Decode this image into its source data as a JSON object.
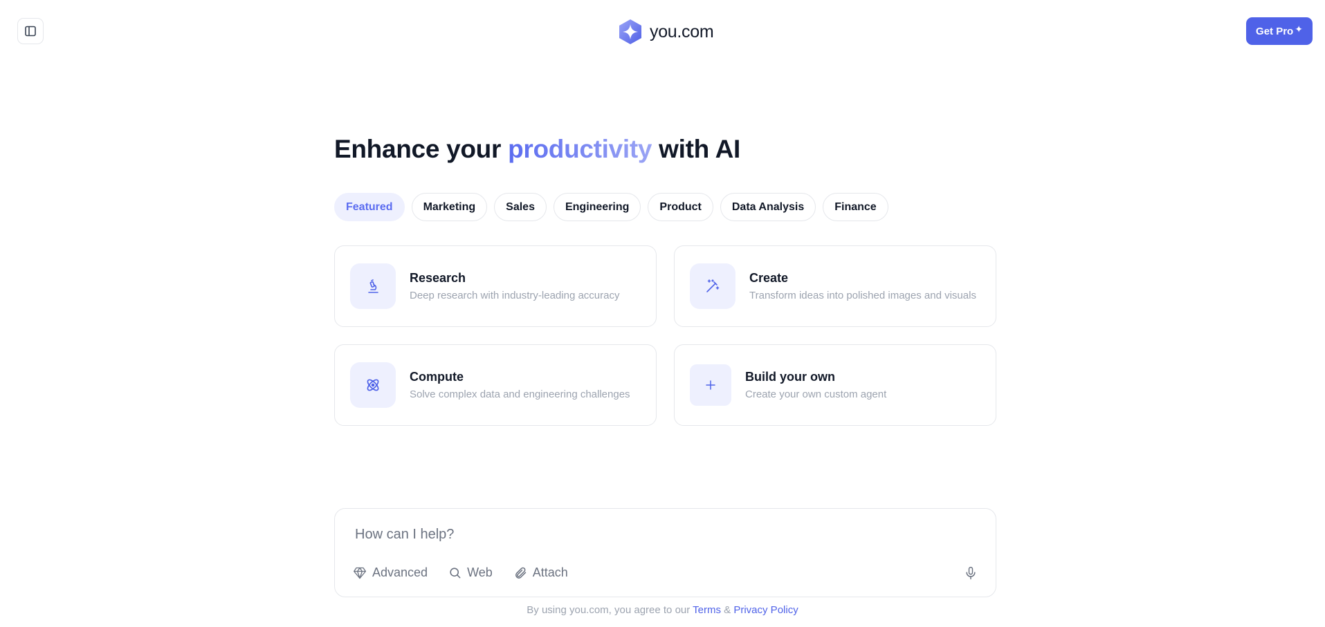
{
  "header": {
    "logo_text": "you.com",
    "get_pro_label": "Get Pro",
    "sparkle": "✦"
  },
  "hero": {
    "title_before": "Enhance your ",
    "title_accent": "productivity",
    "title_after": " with AI"
  },
  "tabs": [
    {
      "label": "Featured",
      "active": true
    },
    {
      "label": "Marketing",
      "active": false
    },
    {
      "label": "Sales",
      "active": false
    },
    {
      "label": "Engineering",
      "active": false
    },
    {
      "label": "Product",
      "active": false
    },
    {
      "label": "Data Analysis",
      "active": false
    },
    {
      "label": "Finance",
      "active": false
    }
  ],
  "cards": [
    {
      "title": "Research",
      "desc": "Deep research with industry-leading accuracy",
      "icon": "microscope-icon"
    },
    {
      "title": "Create",
      "desc": "Transform ideas into polished images and visuals",
      "icon": "magic-wand-icon"
    },
    {
      "title": "Compute",
      "desc": "Solve complex data and engineering challenges",
      "icon": "atom-icon"
    },
    {
      "title": "Build your own",
      "desc": "Create your own custom agent",
      "icon": "plus-icon"
    }
  ],
  "input": {
    "placeholder": "How can I help?",
    "tools": [
      {
        "label": "Advanced",
        "icon": "diamond-icon"
      },
      {
        "label": "Web",
        "icon": "search-icon"
      },
      {
        "label": "Attach",
        "icon": "paperclip-icon"
      }
    ]
  },
  "footer": {
    "prefix": "By using you.com, you agree to our ",
    "terms": "Terms",
    "amp": " & ",
    "privacy": "Privacy Policy"
  },
  "colors": {
    "accent": "#4f62e8",
    "accent_light": "#eef0fe",
    "muted_text": "#9ca3af"
  }
}
